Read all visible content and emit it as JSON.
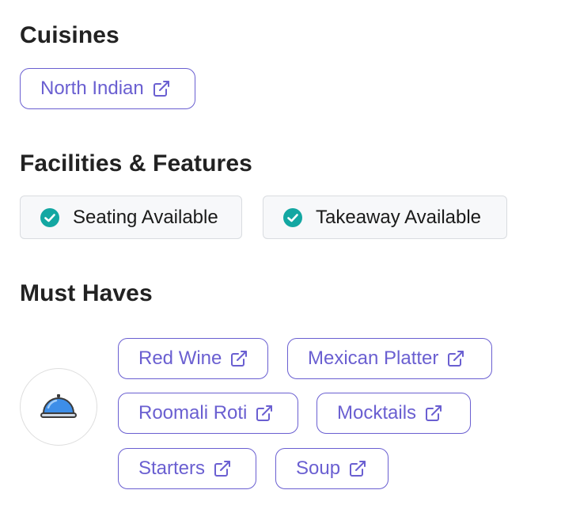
{
  "cuisines": {
    "title": "Cuisines",
    "items": [
      {
        "label": "North Indian",
        "icon": "external-link-icon"
      }
    ]
  },
  "facilities": {
    "title": "Facilities & Features",
    "items": [
      {
        "label": "Seating Available",
        "icon": "check-circle-icon"
      },
      {
        "label": "Takeaway Available",
        "icon": "check-circle-icon"
      }
    ]
  },
  "must_haves": {
    "title": "Must Haves",
    "icon": "food-cloche-icon",
    "items": [
      {
        "label": "Red Wine",
        "icon": "external-link-icon"
      },
      {
        "label": "Mexican Platter",
        "icon": "external-link-icon"
      },
      {
        "label": "Roomali Roti",
        "icon": "external-link-icon"
      },
      {
        "label": "Mocktails",
        "icon": "external-link-icon"
      },
      {
        "label": "Starters",
        "icon": "external-link-icon"
      },
      {
        "label": "Soup",
        "icon": "external-link-icon"
      }
    ]
  },
  "colors": {
    "accent": "#6a5fd1",
    "check": "#13a7a2",
    "feature_bg": "#f7f8fa"
  }
}
